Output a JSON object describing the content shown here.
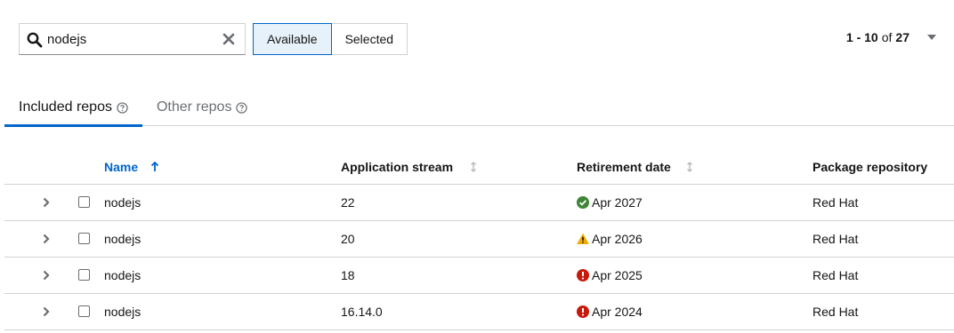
{
  "toolbar": {
    "search_value": "nodejs",
    "toggles": [
      {
        "label": "Available",
        "selected": true
      },
      {
        "label": "Selected",
        "selected": false
      }
    ],
    "pagination": {
      "range": "1 - 10",
      "of": "of",
      "total": "27"
    }
  },
  "tabs": [
    {
      "label": "Included repos",
      "active": true
    },
    {
      "label": "Other repos",
      "active": false
    }
  ],
  "table": {
    "columns": {
      "name": "Name",
      "stream": "Application stream",
      "retirement": "Retirement date",
      "repo": "Package repository"
    },
    "rows": [
      {
        "name": "nodejs",
        "stream": "22",
        "retirement": "Apr 2027",
        "status": "success",
        "repo": "Red Hat"
      },
      {
        "name": "nodejs",
        "stream": "20",
        "retirement": "Apr 2026",
        "status": "warning",
        "repo": "Red Hat"
      },
      {
        "name": "nodejs",
        "stream": "18",
        "retirement": "Apr 2025",
        "status": "danger",
        "repo": "Red Hat"
      },
      {
        "name": "nodejs",
        "stream": "16.14.0",
        "retirement": "Apr 2024",
        "status": "danger",
        "repo": "Red Hat"
      }
    ]
  },
  "colors": {
    "accent": "#0066cc",
    "success": "#3e8635",
    "warning": "#f0ab00",
    "danger": "#c9190b"
  }
}
